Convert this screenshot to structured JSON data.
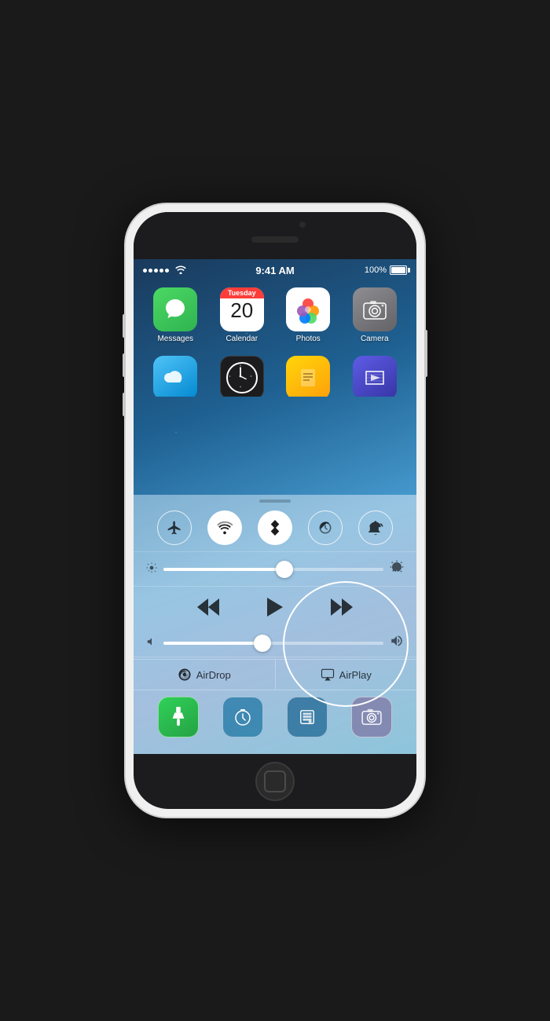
{
  "phone": {
    "status_bar": {
      "time": "9:41 AM",
      "battery_label": "100%",
      "signal_dots": 5
    },
    "home_screen": {
      "apps_row1": [
        {
          "name": "Messages",
          "icon_type": "messages"
        },
        {
          "name": "Calendar",
          "icon_type": "calendar",
          "day": "Tuesday",
          "date": "20"
        },
        {
          "name": "Photos",
          "icon_type": "photos"
        },
        {
          "name": "Camera",
          "icon_type": "camera"
        }
      ],
      "apps_row2": [
        {
          "name": "Weather",
          "icon_type": "weather"
        },
        {
          "name": "Clock",
          "icon_type": "clock"
        },
        {
          "name": "Notes",
          "icon_type": "notes"
        },
        {
          "name": "Videos",
          "icon_type": "videos"
        }
      ]
    },
    "control_center": {
      "toggles": [
        {
          "id": "airplane",
          "label": "Airplane Mode",
          "active": false,
          "symbol": "✈"
        },
        {
          "id": "wifi",
          "label": "Wi-Fi",
          "active": true,
          "symbol": "wifi"
        },
        {
          "id": "bluetooth",
          "label": "Bluetooth",
          "active": true,
          "symbol": "bluetooth"
        },
        {
          "id": "donotdisturb",
          "label": "Do Not Disturb",
          "active": false,
          "symbol": "🌙"
        },
        {
          "id": "rotation",
          "label": "Rotation Lock",
          "active": false,
          "symbol": "rotation"
        }
      ],
      "brightness": {
        "value": 55,
        "label": "Brightness"
      },
      "volume": {
        "value": 45,
        "label": "Volume"
      },
      "media_controls": {
        "rewind_label": "⏮",
        "play_label": "▶",
        "forward_label": "⏭"
      },
      "airdrop_label": "AirDrop",
      "airplay_label": "AirPlay",
      "quick_apps": [
        {
          "name": "Flashlight",
          "icon_type": "flashlight"
        },
        {
          "name": "Timer",
          "icon_type": "timer"
        },
        {
          "name": "Calculator",
          "icon_type": "calculator"
        },
        {
          "name": "Camera",
          "icon_type": "camera"
        }
      ]
    }
  }
}
